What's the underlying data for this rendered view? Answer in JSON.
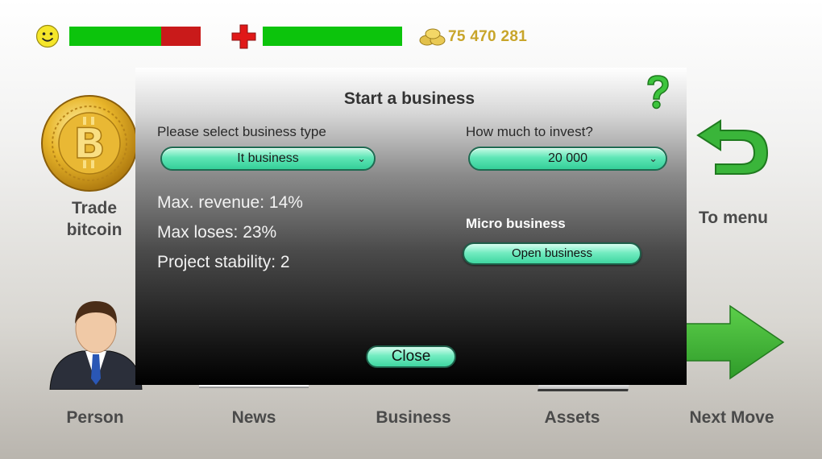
{
  "hud": {
    "happiness_level": 0.7,
    "health_level": 1.0,
    "money": "75 470 281",
    "colors": {
      "good": "#0cc40c",
      "bad": "#c91a1a",
      "money": "#c8a52a"
    }
  },
  "menu": {
    "trade_bitcoin": "Trade\nbitcoin",
    "to_menu": "To menu",
    "person": "Person",
    "news": "News",
    "business": "Business",
    "assets": "Assets",
    "next_move": "Next Move"
  },
  "dialog": {
    "title": "Start a business",
    "type_label": "Please select business type",
    "type_value": "It business",
    "invest_label": "How much to invest?",
    "invest_value": "20 000",
    "max_revenue": "Max. revenue: 14%",
    "max_loses": "Max loses: 23%",
    "stability": "Project stability: 2",
    "business_name": "Micro business",
    "open_label": "Open business",
    "close_label": "Close"
  },
  "icons": [
    "smiley-icon",
    "health-cross-icon",
    "coins-icon",
    "bitcoin-icon",
    "back-arrow-icon",
    "person-icon",
    "next-arrow-icon",
    "help-icon",
    "chevron-down-icon"
  ]
}
